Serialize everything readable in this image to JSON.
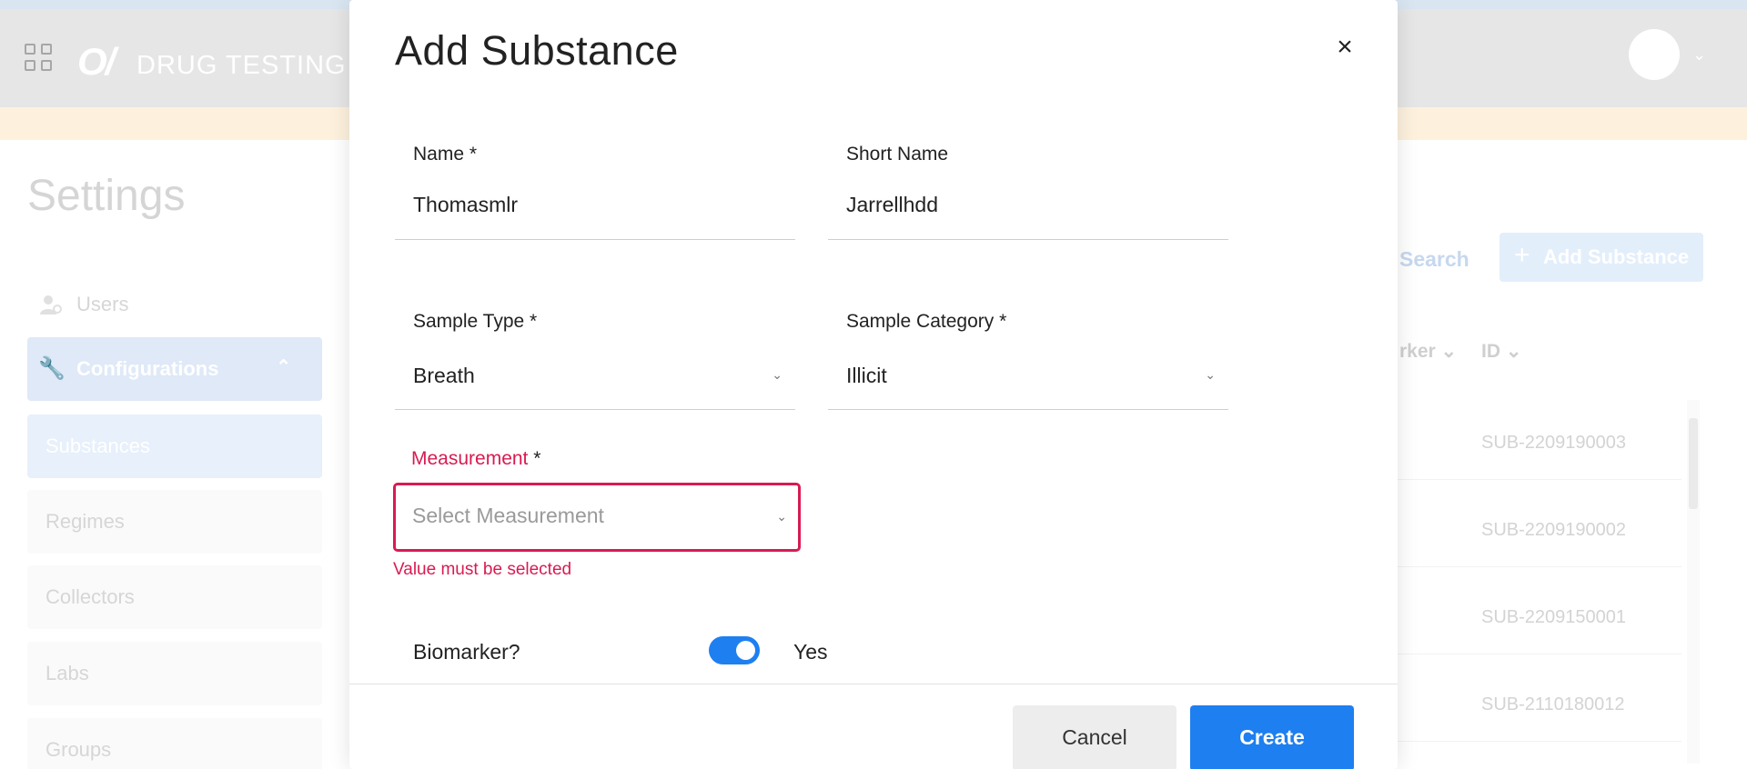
{
  "header": {
    "logo": "O/",
    "brand": "DRUG TESTING"
  },
  "page": {
    "title": "Settings"
  },
  "sidebar": {
    "items": [
      {
        "label": "Users"
      },
      {
        "label": "Configurations"
      },
      {
        "label": "Substances"
      },
      {
        "label": "Regimes"
      },
      {
        "label": "Collectors"
      },
      {
        "label": "Labs"
      },
      {
        "label": "Groups"
      }
    ]
  },
  "content": {
    "search_label": "Search",
    "add_button_label": "Add Substance",
    "columns": [
      "rker",
      "ID"
    ],
    "rows": [
      {
        "id": "SUB-2209190003"
      },
      {
        "id": "SUB-2209190002"
      },
      {
        "id": "SUB-2209150001"
      },
      {
        "id": "SUB-2110180012"
      }
    ]
  },
  "modal": {
    "title": "Add Substance",
    "fields": {
      "name": {
        "label": "Name *",
        "value": "Thomasmlr"
      },
      "short_name": {
        "label": "Short Name",
        "value": "Jarrellhdd"
      },
      "sample_type": {
        "label": "Sample Type *",
        "value": "Breath"
      },
      "sample_category": {
        "label": "Sample Category *",
        "value": "Illicit"
      },
      "measurement": {
        "label": "Measurement",
        "required_mark": "*",
        "placeholder": "Select Measurement",
        "error": "Value must be selected"
      },
      "biomarker": {
        "label": "Biomarker?",
        "value": "Yes",
        "enabled": true
      }
    },
    "buttons": {
      "cancel": "Cancel",
      "create": "Create"
    }
  },
  "colors": {
    "primary": "#1e7ff0",
    "error": "#d81b52"
  }
}
